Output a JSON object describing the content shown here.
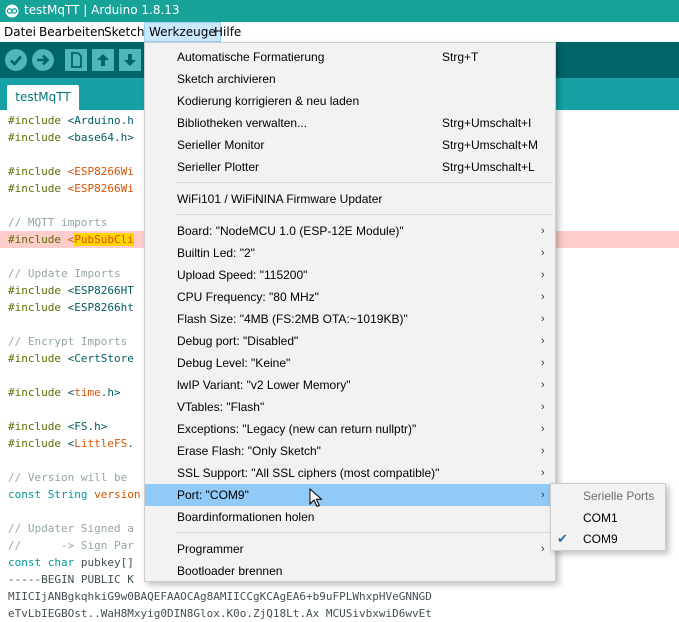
{
  "window": {
    "title": "testMqTT | Arduino 1.8.13"
  },
  "menubar": {
    "items": [
      "Datei",
      "Bearbeiten",
      "Sketch",
      "Werkzeuge",
      "Hilfe"
    ],
    "active": "Werkzeuge"
  },
  "toolbar": {
    "buttons": [
      "verify-icon",
      "upload-icon",
      "new-icon",
      "open-icon",
      "save-icon"
    ]
  },
  "tab": {
    "label": "testMqTT"
  },
  "editor": {
    "lines": [
      "#include <Arduino.h",
      "#include <base64.h>",
      "",
      "#include <ESP8266Wi",
      "#include <ESP8266Wi",
      "",
      "// MQTT imports",
      "#include <PubSubCli",
      "",
      "// Update Imports",
      "#include <ESP8266HT",
      "#include <ESP8266ht",
      "",
      "// Encrypt Imports",
      "#include <CertStore",
      "",
      "#include <time.h>",
      "",
      "#include <FS.h>",
      "#include <LittleFS.",
      "",
      "// Version will be ",
      "const String version",
      "",
      "// Updater Signed a",
      "//      -> Sign Par",
      "const char pubkey[]",
      "-----BEGIN PUBLIC K",
      "MIICIjANBgkqhkiG9w0BAQEFAAOCAg8AMIICCgKCAgEA6+b9uFPLWhxpHVeGNNGD",
      "eTvLbIEGBOst..WaH8Mxyig0DIN8Glox.K0o.ZjQ18Lt.Ax MCUSivbxwiD6wvEt"
    ]
  },
  "tools_menu": {
    "items": [
      {
        "label": "Automatische Formatierung",
        "shortcut": "Strg+T"
      },
      {
        "label": "Sketch archivieren",
        "shortcut": ""
      },
      {
        "label": "Kodierung korrigieren & neu laden",
        "shortcut": ""
      },
      {
        "label": "Bibliotheken verwalten...",
        "shortcut": "Strg+Umschalt+I"
      },
      {
        "label": "Serieller Monitor",
        "shortcut": "Strg+Umschalt+M"
      },
      {
        "label": "Serieller Plotter",
        "shortcut": "Strg+Umschalt+L"
      },
      {
        "label": "WiFi101 / WiFiNINA Firmware Updater",
        "shortcut": ""
      },
      {
        "label": "Board: \"NodeMCU 1.0 (ESP-12E Module)\"",
        "submenu": true
      },
      {
        "label": "Builtin Led: \"2\"",
        "submenu": true
      },
      {
        "label": "Upload Speed: \"115200\"",
        "submenu": true
      },
      {
        "label": "CPU Frequency: \"80 MHz\"",
        "submenu": true
      },
      {
        "label": "Flash Size: \"4MB (FS:2MB OTA:~1019KB)\"",
        "submenu": true
      },
      {
        "label": "Debug port: \"Disabled\"",
        "submenu": true
      },
      {
        "label": "Debug Level: \"Keine\"",
        "submenu": true
      },
      {
        "label": "lwIP Variant: \"v2 Lower Memory\"",
        "submenu": true
      },
      {
        "label": "VTables: \"Flash\"",
        "submenu": true
      },
      {
        "label": "Exceptions: \"Legacy (new can return nullptr)\"",
        "submenu": true
      },
      {
        "label": "Erase Flash: \"Only Sketch\"",
        "submenu": true
      },
      {
        "label": "SSL Support: \"All SSL ciphers (most compatible)\"",
        "submenu": true
      },
      {
        "label": "Port: \"COM9\"",
        "submenu": true,
        "highlighted": true
      },
      {
        "label": "Boardinformationen holen",
        "shortcut": ""
      },
      {
        "label": "Programmer",
        "submenu": true
      },
      {
        "label": "Bootloader brennen",
        "shortcut": ""
      }
    ],
    "submenu_arrow": "›"
  },
  "port_submenu": {
    "header": "Serielle Ports",
    "items": [
      {
        "label": "COM1",
        "checked": false
      },
      {
        "label": "COM9",
        "checked": true
      }
    ],
    "check_glyph": "✔"
  },
  "colors": {
    "titlebar": "#17a398",
    "toolbar": "#006468",
    "tabstrip": "#17a1a5",
    "menu_highlight": "#91c9f7",
    "error_line": "#ffcccc"
  }
}
